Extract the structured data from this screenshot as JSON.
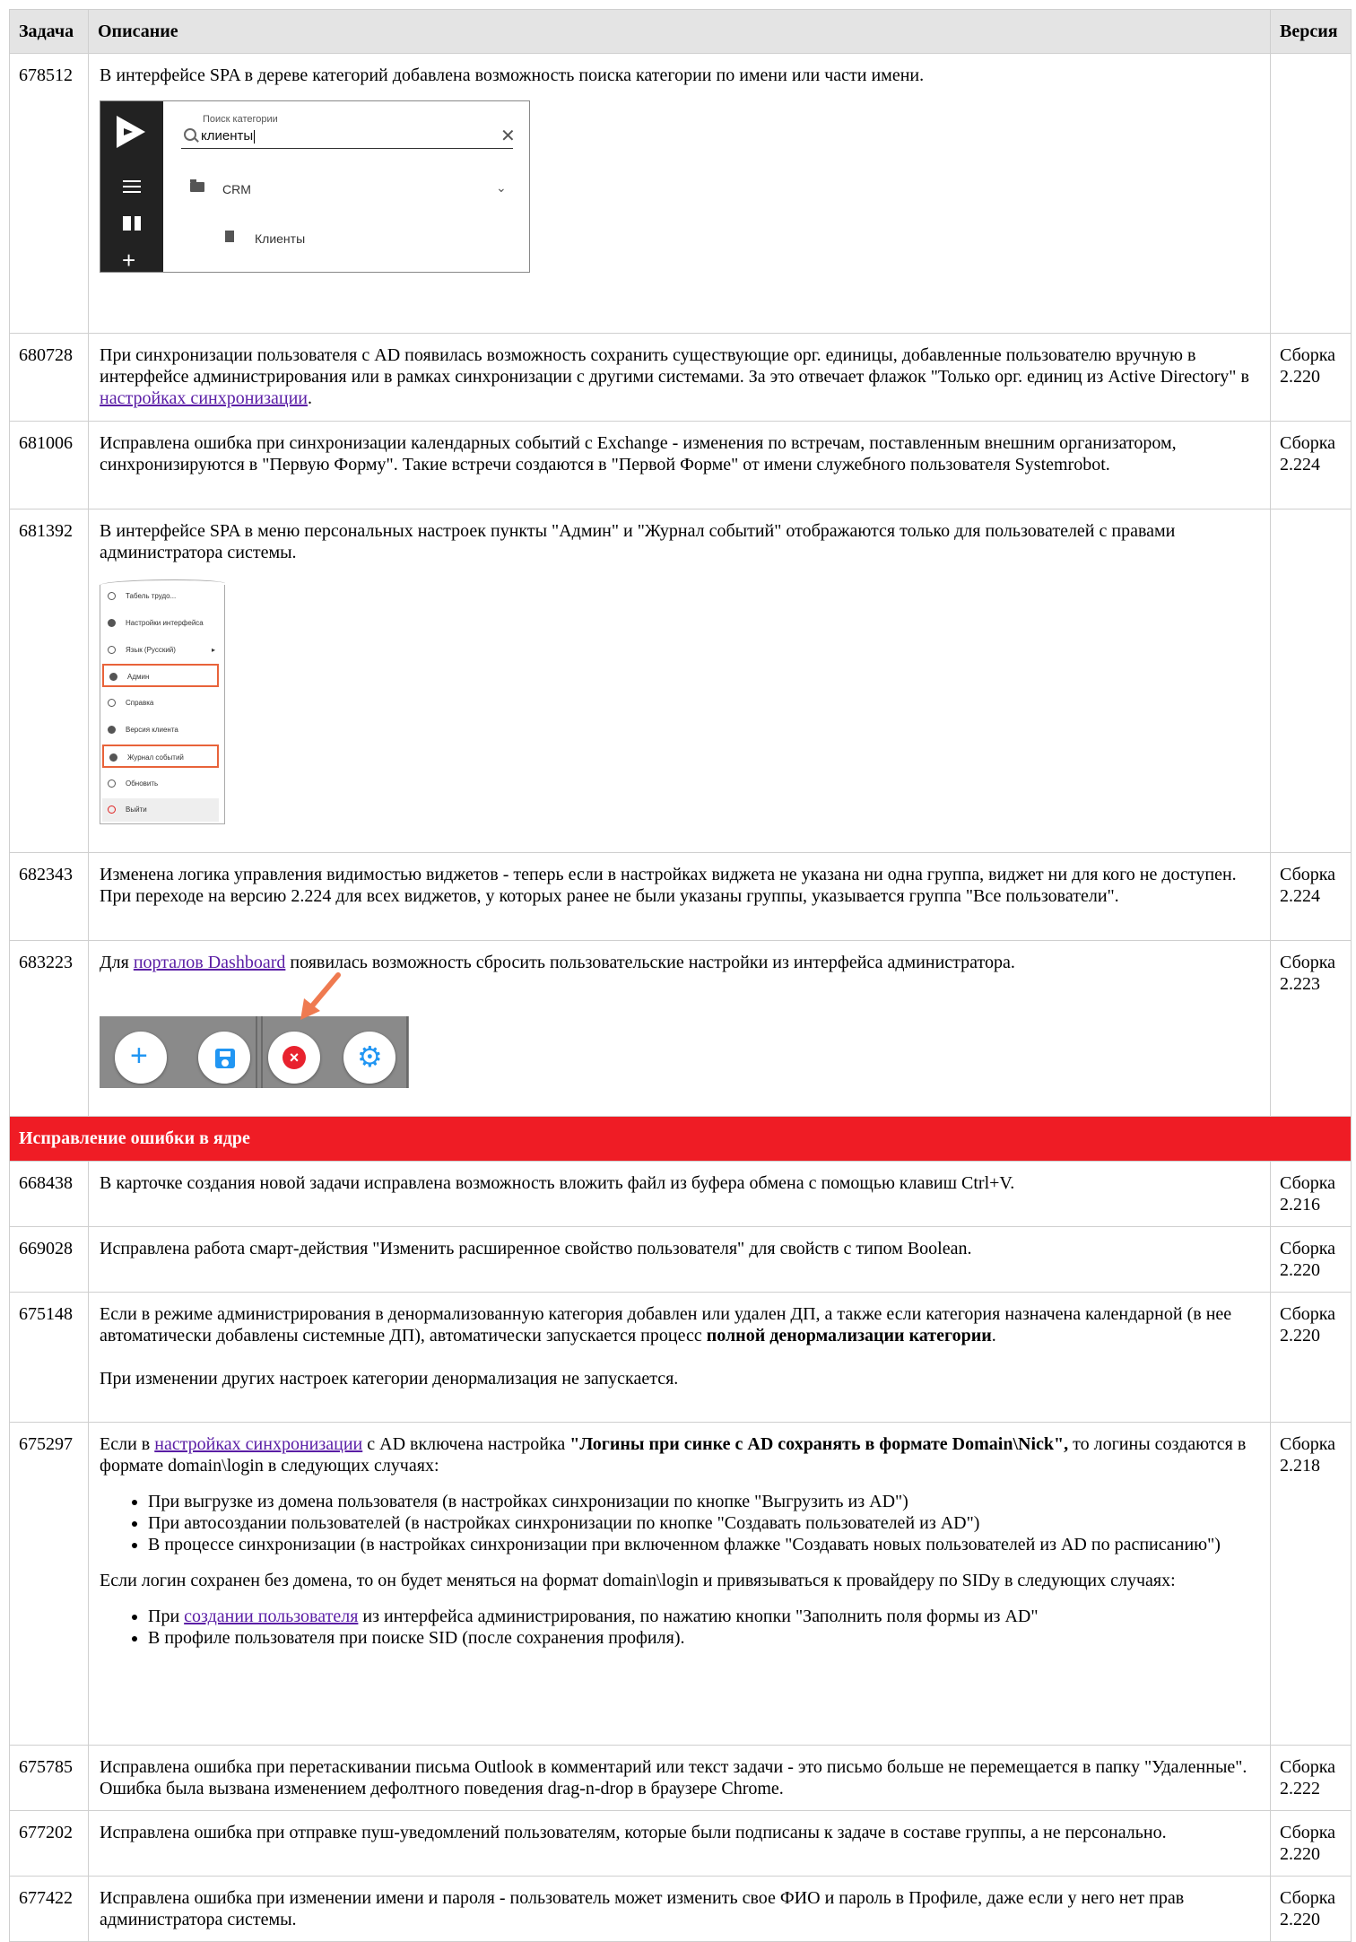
{
  "headers": {
    "task": "Задача",
    "description": "Описание",
    "version": "Версия"
  },
  "mock_tree": {
    "search_label": "Поиск категории",
    "search_value": "клиенты",
    "folder": "CRM",
    "leaf": "Клиенты"
  },
  "mock_menu": {
    "items": [
      "Табель трудо...",
      "Настройки интерфейса",
      "Язык (Русский)",
      "Админ",
      "Справка",
      "Версия клиента",
      "Журнал событий",
      "Обновить",
      "Выйти"
    ]
  },
  "rows": [
    {
      "id": "678512",
      "text": "В интерфейсе SPA в дереве категорий добавлена возможность поиска категории по имени или части имени.",
      "ver1": "",
      "ver2": ""
    },
    {
      "id": "680728",
      "text_a": "При синхронизации пользователя с AD появилась возможность сохранить существующие орг. единицы, добавленные пользователю вручную в интерфейсе администрирования или в рамках синхронизации с другими системами. За это отвечает флажок \"Только орг. единиц из Active Directory\" в ",
      "link": "настройках синхронизации",
      "text_b": ".",
      "ver1": "Сборка",
      "ver2": "2.220"
    },
    {
      "id": "681006",
      "text": "Исправлена ошибка при синхронизации календарных событий с Exchange - изменения по встречам, поставленным внешним организатором, синхронизируются в \"Первую Форму\". Такие встречи создаются в \"Первой Форме\" от имени служебного пользователя Systemrobot.",
      "ver1": "Сборка",
      "ver2": "2.224"
    },
    {
      "id": "681392",
      "text": "В интерфейсе SPA в меню персональных настроек пункты \"Админ\" и \"Журнал событий\" отображаются только для пользователей с правами администратора системы.",
      "ver1": "",
      "ver2": ""
    },
    {
      "id": "682343",
      "text": "Изменена логика управления видимостью виджетов - теперь если в настройках виджета не указана ни одна группа, виджет ни для кого не доступен. При переходе на версию 2.224 для всех виджетов, у которых ранее не были указаны группы, указывается группа \"Все пользователи\".",
      "ver1": "Сборка",
      "ver2": "2.224"
    },
    {
      "id": "683223",
      "text_a": "Для ",
      "link": "порталов Dashboard",
      "text_b": " появилась возможность сбросить пользовательские настройки из интерфейса администратора.",
      "ver1": "Сборка",
      "ver2": "2.223"
    }
  ],
  "section": {
    "title": "Исправление ошибки в ядре"
  },
  "rows2": [
    {
      "id": "668438",
      "text": "В карточке создания новой задачи исправлена возможность вложить файл из буфера обмена с помощью клавиш Ctrl+V.",
      "ver1": "Сборка",
      "ver2": "2.216"
    },
    {
      "id": "669028",
      "text": "Исправлена работа смарт-действия \"Изменить расширенное свойство пользователя\" для свойств с типом Boolean.",
      "ver1": "Сборка",
      "ver2": "2.220"
    },
    {
      "id": "675148",
      "text_a": "Если в режиме администрирования в денормализованную категория добавлен или удален ДП, а также если категория назначена календарной (в нее автоматически добавлены системные ДП), автоматически запускается процесс ",
      "bold": "полной денормализации категории",
      "text_b": ".",
      "text_c": "При изменении других настроек категории денормализация не запускается.",
      "ver1": "Сборка",
      "ver2": "2.220"
    },
    {
      "id": "675297",
      "text_a": "Если в ",
      "link1": "настройках синхронизации",
      "text_b": " с AD включена настройка ",
      "bold": "\"Логины при синке с AD сохранять в формате Domain\\Nick\",",
      "text_c": " то логины создаются в формате domain\\login в следующих случаях:",
      "list1": [
        "При выгрузке из домена пользователя (в настройках синхронизации по кнопке \"Выгрузить из AD\")",
        "При автосоздании пользователей (в настройках синхронизации по кнопке \"Создавать пользователей из AD\")",
        "В процессе синхронизации (в настройках синхронизации при включенном флажке \"Создавать новых пользователей из AD по расписанию\")"
      ],
      "text_d": "Если логин сохранен без домена, то он будет меняться на формат domain\\login и привязываться к провайдеру по SIDу в следующих случаях:",
      "li_a": "При ",
      "link2": "создании пользователя",
      "li_b": " из интерфейса администрирования, по нажатию кнопки \"Заполнить поля формы из AD\"",
      "li2": "В профиле пользователя при поиске SID (после сохранения профиля).",
      "ver1": "Сборка",
      "ver2": "2.218"
    },
    {
      "id": "675785",
      "text": "Исправлена ошибка при перетаскивании письма Outlook в комментарий или текст задачи - это письмо больше не перемещается в папку \"Удаленные\". Ошибка была вызвана изменением дефолтного поведения drag-n-drop в браузере Chrome.",
      "ver1": "Сборка",
      "ver2": "2.222"
    },
    {
      "id": "677202",
      "text": "Исправлена ошибка при отправке пуш-уведомлений пользователям, которые были подписаны к задаче в составе группы, а не персонально.",
      "ver1": "Сборка",
      "ver2": "2.220"
    },
    {
      "id": "677422",
      "text": "Исправлена ошибка при изменении имени и пароля - пользователь может изменить свое ФИО и пароль в Профиле, даже если у него нет прав администратора системы.",
      "ver1": "Сборка",
      "ver2": "2.220"
    }
  ]
}
